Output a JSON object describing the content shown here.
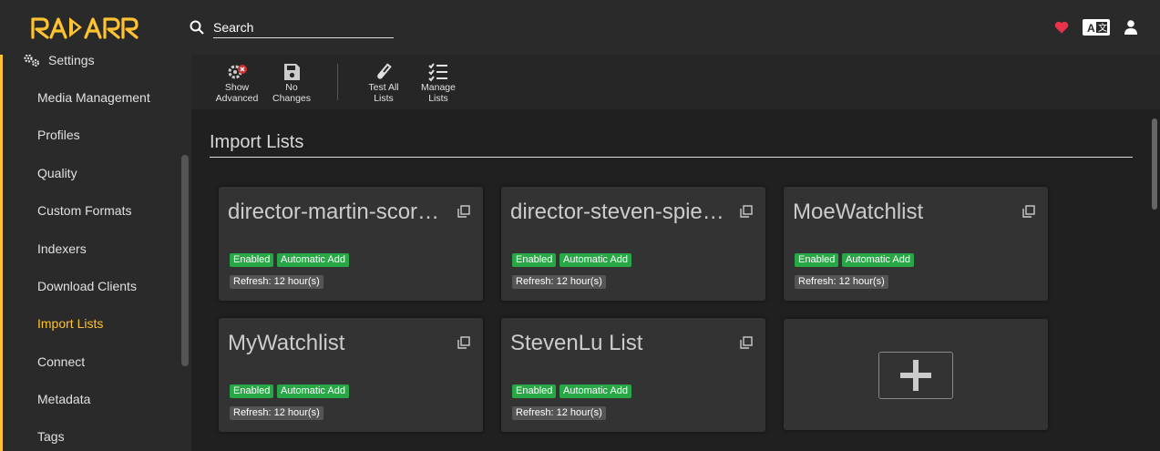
{
  "app": {
    "logo_text": "RADARR",
    "accent": "#ffc230"
  },
  "search": {
    "placeholder": "Search"
  },
  "header_icons": [
    "heart-icon",
    "translate-icon",
    "user-icon"
  ],
  "sidebar": {
    "parent": "Settings",
    "items": [
      {
        "label": "Media Management"
      },
      {
        "label": "Profiles"
      },
      {
        "label": "Quality"
      },
      {
        "label": "Custom Formats"
      },
      {
        "label": "Indexers"
      },
      {
        "label": "Download Clients"
      },
      {
        "label": "Import Lists",
        "active": true
      },
      {
        "label": "Connect"
      },
      {
        "label": "Metadata"
      },
      {
        "label": "Tags"
      }
    ]
  },
  "toolbar": {
    "show_advanced": {
      "line1": "Show",
      "line2": "Advanced"
    },
    "no_changes": {
      "line1": "No",
      "line2": "Changes"
    },
    "test_all": {
      "line1": "Test All",
      "line2": "Lists"
    },
    "manage": {
      "line1": "Manage",
      "line2": "Lists"
    }
  },
  "page": {
    "title": "Import Lists"
  },
  "cards": [
    {
      "name": "director-martin-scorsese",
      "enabled": "Enabled",
      "auto_add": "Automatic Add",
      "refresh": "Refresh: 12 hour(s)"
    },
    {
      "name": "director-steven-spielberg",
      "enabled": "Enabled",
      "auto_add": "Automatic Add",
      "refresh": "Refresh: 12 hour(s)"
    },
    {
      "name": "MoeWatchlist",
      "enabled": "Enabled",
      "auto_add": "Automatic Add",
      "refresh": "Refresh: 12 hour(s)"
    },
    {
      "name": "MyWatchlist",
      "enabled": "Enabled",
      "auto_add": "Automatic Add",
      "refresh": "Refresh: 12 hour(s)"
    },
    {
      "name": "StevenLu List",
      "enabled": "Enabled",
      "auto_add": "Automatic Add",
      "refresh": "Refresh: 12 hour(s)"
    }
  ]
}
